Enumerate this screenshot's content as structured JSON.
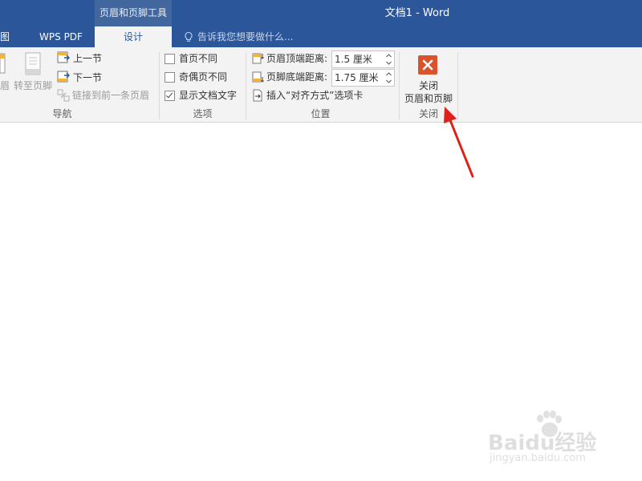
{
  "window": {
    "title": "文档1 - Word",
    "context_group": "页眉和页脚工具"
  },
  "tabs": {
    "view": "视图",
    "wps_pdf": "WPS PDF",
    "design": "设计"
  },
  "tell_me": {
    "placeholder": "告诉我您想要做什么..."
  },
  "ribbon": {
    "navigation": {
      "header_partial": "眉",
      "goto_footer": "转至页脚",
      "previous": "上一节",
      "next": "下一节",
      "link_previous": "链接到前一条页眉",
      "label": "导航"
    },
    "options": {
      "different_first_page": {
        "label": "首页不同",
        "checked": false
      },
      "different_odd_even": {
        "label": "奇偶页不同",
        "checked": false
      },
      "show_document_text": {
        "label": "显示文档文字",
        "checked": true
      },
      "label": "选项"
    },
    "position": {
      "header_from_top": {
        "label": "页眉顶端距离:",
        "value": "1.5 厘米"
      },
      "footer_from_bottom": {
        "label": "页脚底端距离:",
        "value": "1.75 厘米"
      },
      "insert_alignment_tab": "插入“对齐方式”选项卡",
      "label": "位置"
    },
    "close": {
      "line1": "关闭",
      "line2": "页眉和页脚",
      "label": "关闭"
    }
  },
  "watermark": {
    "brand": "Baidu经验",
    "url": "jingyan.baidu.com"
  },
  "colors": {
    "title_bar": "#2b579a",
    "ribbon_bg": "#f3f3f3",
    "close_icon": "#d9542c",
    "annotation_arrow": "#e0201b"
  }
}
